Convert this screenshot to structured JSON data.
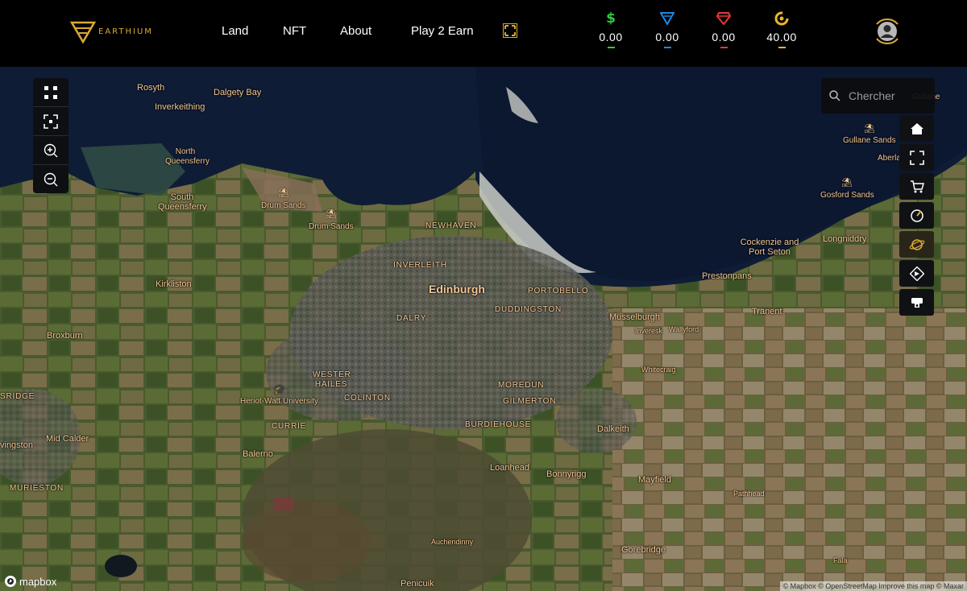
{
  "brand": {
    "name": "EARTHIUM",
    "logo_icon": "earthium-triangle-logo"
  },
  "nav": {
    "land": "Land",
    "nft": "NFT",
    "about": "About",
    "play_to_earn": "Play 2 Earn"
  },
  "wallets": [
    {
      "icon": "dollar-icon",
      "value": "0.00",
      "color": "#2ecc40"
    },
    {
      "icon": "blue-triangle-gem-icon",
      "value": "0.00",
      "color": "#1e88e5"
    },
    {
      "icon": "red-diamond-icon",
      "value": "0.00",
      "color": "#e53935"
    },
    {
      "icon": "gold-coin-icon",
      "value": "40.00",
      "color": "#f0b429"
    }
  ],
  "search": {
    "placeholder": "Chercher"
  },
  "colors": {
    "accent": "#d9a934",
    "topbar": "#000000",
    "label": "#f2c794"
  },
  "map": {
    "labels": [
      "Rosyth",
      "Dalgety Bay",
      "Inverkeithing",
      "North Queensferry",
      "South Queensferry",
      "Drum Sands",
      "Drum Sands",
      "NEWHAVEN",
      "INVERLEITH",
      "Edinburgh",
      "PORTOBELLO",
      "DUDDINGSTON",
      "DALRY",
      "Kirkliston",
      "Broxburn",
      "WESTER HAILES",
      "Heriot-Watt University",
      "COLINTON",
      "CURRIE",
      "MOREDUN",
      "GILMERTON",
      "BURDIEHOUSE",
      "Musselburgh",
      "Inveresk",
      "Wallyford",
      "Whitecraig",
      "Dalkeith",
      "Loanhead",
      "Bonnyrigg",
      "Mayfield",
      "Pathhead",
      "Gorebridge",
      "Fala",
      "Auchendinny",
      "Penicuik",
      "Balerno",
      "Mid Calder",
      "MURIESTON",
      "SRIDGE",
      "vingston",
      "Cockenzie and Port Seton",
      "Prestonpans",
      "Tranent",
      "Longniddry",
      "Gosford Sands",
      "Gullane Sands",
      "Aberla",
      "Gullane"
    ],
    "mapbox_text": "mapbox",
    "attribution": "© Mapbox © OpenStreetMap Improve this map © Maxar"
  }
}
